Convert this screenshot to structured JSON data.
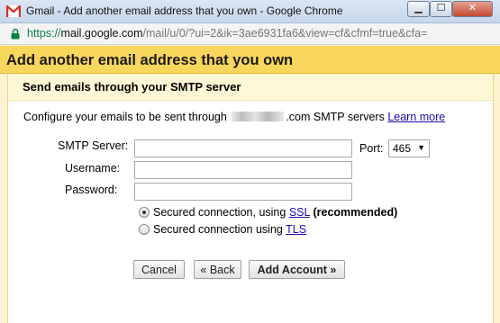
{
  "browser": {
    "window_title": "Gmail - Add another email address that you own - Google Chrome",
    "url_protocol": "https://",
    "url_host": "mail.google.com",
    "url_path": "/mail/u/0/?ui=2&ik=3ae6931fa6&view=cf&cfmf=true&cfa="
  },
  "dialog": {
    "title": "Add another email address that you own",
    "subheader": "Send emails through your SMTP server",
    "description_prefix": "Configure your emails to be sent through",
    "description_suffix": ".com SMTP servers",
    "learn_more": "Learn more"
  },
  "form": {
    "smtp_label": "SMTP Server:",
    "smtp_value": "",
    "port_label": "Port:",
    "port_value": "465",
    "username_label": "Username:",
    "username_value": "",
    "password_label": "Password:",
    "password_value": "",
    "ssl_prefix": "Secured connection, using",
    "ssl_link": "SSL",
    "ssl_suffix": "(recommended)",
    "tls_prefix": "Secured connection using",
    "tls_link": "TLS",
    "selected_security": "SSL"
  },
  "buttons": {
    "cancel": "Cancel",
    "back": "« Back",
    "add_account": "Add Account »"
  },
  "colors": {
    "header_yellow": "#f9d65c",
    "link_blue": "#1a0dab",
    "gmail_red": "#d93025"
  }
}
